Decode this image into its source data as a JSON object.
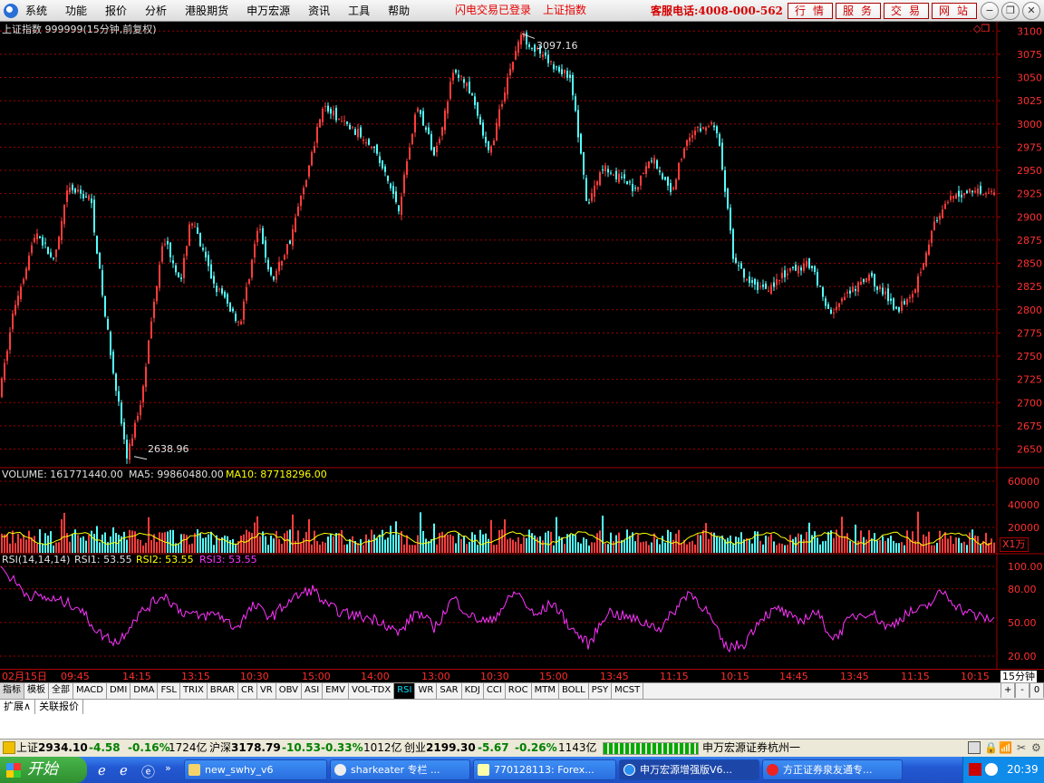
{
  "menu": {
    "items": [
      "系统",
      "功能",
      "报价",
      "分析",
      "港股期货",
      "申万宏源",
      "资讯",
      "工具",
      "帮助"
    ],
    "notice1": "闪电交易已登录",
    "notice2": "上证指数",
    "hotline": "客服电话:4008-000-562",
    "buttons": [
      "行情",
      "服务",
      "交易",
      "网站"
    ]
  },
  "chart": {
    "title": "上证指数 999999(15分钟,前复权)",
    "high_label": "3097.16",
    "low_label": "2638.96",
    "price_ticks": [
      "3100",
      "3075",
      "3050",
      "3025",
      "3000",
      "2975",
      "2950",
      "2925",
      "2900",
      "2875",
      "2850",
      "2825",
      "2800",
      "2775",
      "2750",
      "2725",
      "2700",
      "2675",
      "2650"
    ],
    "volume_label": "VOLUME: 161771440.00",
    "ma5_label": "MA5: 99860480.00",
    "ma10_label": "MA10: 87718296.00",
    "volume_ticks": [
      "60000",
      "40000",
      "20000"
    ],
    "volume_unit": "X1万",
    "rsi_label": "RSI(14,14,14)",
    "rsi1_label": "RSI1: 53.55",
    "rsi2_label": "RSI2: 53.55",
    "rsi3_label": "RSI3: 53.55",
    "rsi_ticks": [
      "100.00",
      "80.00",
      "50.00",
      "20.00"
    ],
    "time_labels": [
      "02月15日",
      "09:45",
      "14:15",
      "13:15",
      "10:30",
      "15:00",
      "14:00",
      "13:00",
      "10:30",
      "15:00",
      "13:45",
      "11:15",
      "10:15",
      "14:45",
      "13:45",
      "11:15",
      "10:15"
    ],
    "period": "15分钟",
    "colors": {
      "up": "#ff3c3c",
      "down": "#54ffff",
      "ma10": "#ffff00",
      "rsi": "#ff33ff",
      "grid": "#a00000"
    }
  },
  "chart_data": {
    "type": "candlestick",
    "ylim": [
      2630,
      3110
    ],
    "anchors": [
      [
        0,
        2710
      ],
      [
        15,
        2800
      ],
      [
        40,
        2885
      ],
      [
        60,
        2850
      ],
      [
        75,
        2930
      ],
      [
        100,
        2920
      ],
      [
        115,
        2800
      ],
      [
        140,
        2640
      ],
      [
        155,
        2700
      ],
      [
        180,
        2880
      ],
      [
        200,
        2830
      ],
      [
        210,
        2900
      ],
      [
        235,
        2830
      ],
      [
        265,
        2785
      ],
      [
        285,
        2890
      ],
      [
        300,
        2830
      ],
      [
        320,
        2875
      ],
      [
        345,
        2970
      ],
      [
        355,
        3020
      ],
      [
        380,
        3000
      ],
      [
        410,
        2980
      ],
      [
        440,
        2910
      ],
      [
        460,
        3020
      ],
      [
        480,
        2965
      ],
      [
        500,
        3055
      ],
      [
        515,
        3045
      ],
      [
        540,
        2965
      ],
      [
        560,
        3050
      ],
      [
        575,
        3097
      ],
      [
        600,
        3070
      ],
      [
        630,
        3050
      ],
      [
        648,
        2910
      ],
      [
        665,
        2955
      ],
      [
        700,
        2930
      ],
      [
        720,
        2965
      ],
      [
        740,
        2925
      ],
      [
        760,
        2990
      ],
      [
        790,
        3000
      ],
      [
        800,
        2930
      ],
      [
        810,
        2850
      ],
      [
        830,
        2825
      ],
      [
        850,
        2825
      ],
      [
        870,
        2840
      ],
      [
        895,
        2850
      ],
      [
        915,
        2795
      ],
      [
        940,
        2820
      ],
      [
        960,
        2835
      ],
      [
        990,
        2800
      ],
      [
        1010,
        2825
      ],
      [
        1030,
        2890
      ],
      [
        1050,
        2920
      ],
      [
        1075,
        2930
      ],
      [
        1100,
        2925
      ]
    ],
    "rsi_anchors": [
      [
        0,
        100
      ],
      [
        30,
        75
      ],
      [
        60,
        70
      ],
      [
        85,
        65
      ],
      [
        110,
        40
      ],
      [
        130,
        32
      ],
      [
        150,
        55
      ],
      [
        180,
        75
      ],
      [
        200,
        60
      ],
      [
        220,
        55
      ],
      [
        240,
        58
      ],
      [
        260,
        45
      ],
      [
        280,
        65
      ],
      [
        300,
        55
      ],
      [
        320,
        70
      ],
      [
        345,
        80
      ],
      [
        360,
        65
      ],
      [
        380,
        58
      ],
      [
        400,
        55
      ],
      [
        420,
        52
      ],
      [
        440,
        40
      ],
      [
        460,
        60
      ],
      [
        480,
        45
      ],
      [
        500,
        72
      ],
      [
        520,
        55
      ],
      [
        540,
        50
      ],
      [
        570,
        78
      ],
      [
        590,
        55
      ],
      [
        610,
        68
      ],
      [
        630,
        45
      ],
      [
        650,
        30
      ],
      [
        670,
        60
      ],
      [
        690,
        55
      ],
      [
        710,
        50
      ],
      [
        730,
        45
      ],
      [
        760,
        78
      ],
      [
        780,
        60
      ],
      [
        800,
        28
      ],
      [
        820,
        30
      ],
      [
        840,
        55
      ],
      [
        860,
        62
      ],
      [
        880,
        50
      ],
      [
        900,
        60
      ],
      [
        920,
        35
      ],
      [
        940,
        55
      ],
      [
        960,
        60
      ],
      [
        980,
        45
      ],
      [
        1000,
        58
      ],
      [
        1020,
        62
      ],
      [
        1040,
        78
      ],
      [
        1060,
        62
      ],
      [
        1080,
        55
      ],
      [
        1100,
        52
      ]
    ]
  },
  "tabs": [
    "指标",
    "模板",
    "全部",
    "MACD",
    "DMI",
    "DMA",
    "FSL",
    "TRIX",
    "BRAR",
    "CR",
    "VR",
    "OBV",
    "ASI",
    "EMV",
    "VOL-TDX",
    "RSI",
    "WR",
    "SAR",
    "KDJ",
    "CCI",
    "ROC",
    "MTM",
    "BOLL",
    "PSY",
    "MCST"
  ],
  "tab_right": [
    "+",
    "-",
    "0"
  ],
  "ext_tabs": [
    "扩展∧",
    "关联报价"
  ],
  "status": {
    "sh_name": "上证",
    "sh_val": "2934.10",
    "sh_chg": "-4.58",
    "sh_pct": "-0.16%",
    "sh_amt": "1724亿",
    "sz_name": "沪深",
    "sz_val": "3178.79",
    "sz_chg": "-10.53",
    "sz_pct": "-0.33%",
    "sz_amt": "1012亿",
    "cy_name": "创业",
    "cy_val": "2199.30",
    "cy_chg": "-5.67",
    "cy_pct": "-0.26%",
    "cy_amt": "1143亿",
    "broker": "申万宏源证券杭州一"
  },
  "taskbar": {
    "start": "开始",
    "tasks": [
      "new_swhy_v6",
      "sharkeater 专栏 ...",
      "770128113: Forex...",
      "申万宏源增强版V6...",
      "方正证券泉友通专..."
    ],
    "clock": "20:39"
  }
}
